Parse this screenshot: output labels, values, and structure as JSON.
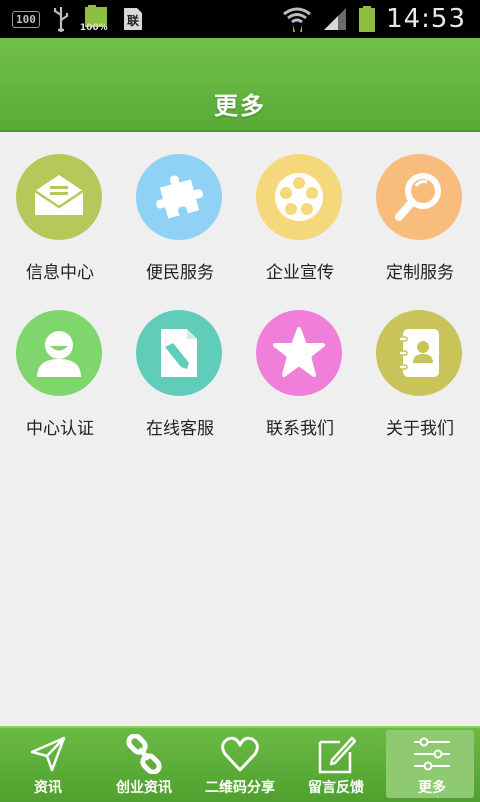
{
  "status_bar": {
    "notif_icons": [
      "screenshot-icon",
      "usb-icon",
      "battery-full-icon",
      "sim-icon"
    ],
    "box_label": "100",
    "battery_pct": "100%",
    "sim_label": "联",
    "time": "14:53"
  },
  "header": {
    "title": "更多"
  },
  "grid": {
    "items": [
      {
        "label": "信息中心",
        "icon": "envelope-icon",
        "color": "#b5c95a"
      },
      {
        "label": "便民服务",
        "icon": "puzzle-icon",
        "color": "#8fd2f5"
      },
      {
        "label": "企业宣传",
        "icon": "film-reel-icon",
        "color": "#f4d87b"
      },
      {
        "label": "定制服务",
        "icon": "magnifier-icon",
        "color": "#f8bd7c"
      },
      {
        "label": "中心认证",
        "icon": "user-icon",
        "color": "#7fd66c"
      },
      {
        "label": "在线客服",
        "icon": "edit-document-icon",
        "color": "#5fcdb9"
      },
      {
        "label": "联系我们",
        "icon": "star-icon",
        "color": "#f07fd9"
      },
      {
        "label": "关于我们",
        "icon": "contacts-book-icon",
        "color": "#c9c45a"
      }
    ]
  },
  "tabbar": {
    "items": [
      {
        "label": "资讯",
        "icon": "paper-plane-icon"
      },
      {
        "label": "创业资讯",
        "icon": "chain-link-icon"
      },
      {
        "label": "二维码分享",
        "icon": "heart-icon"
      },
      {
        "label": "留言反馈",
        "icon": "edit-icon"
      },
      {
        "label": "更多",
        "icon": "sliders-icon",
        "active": true
      }
    ]
  }
}
